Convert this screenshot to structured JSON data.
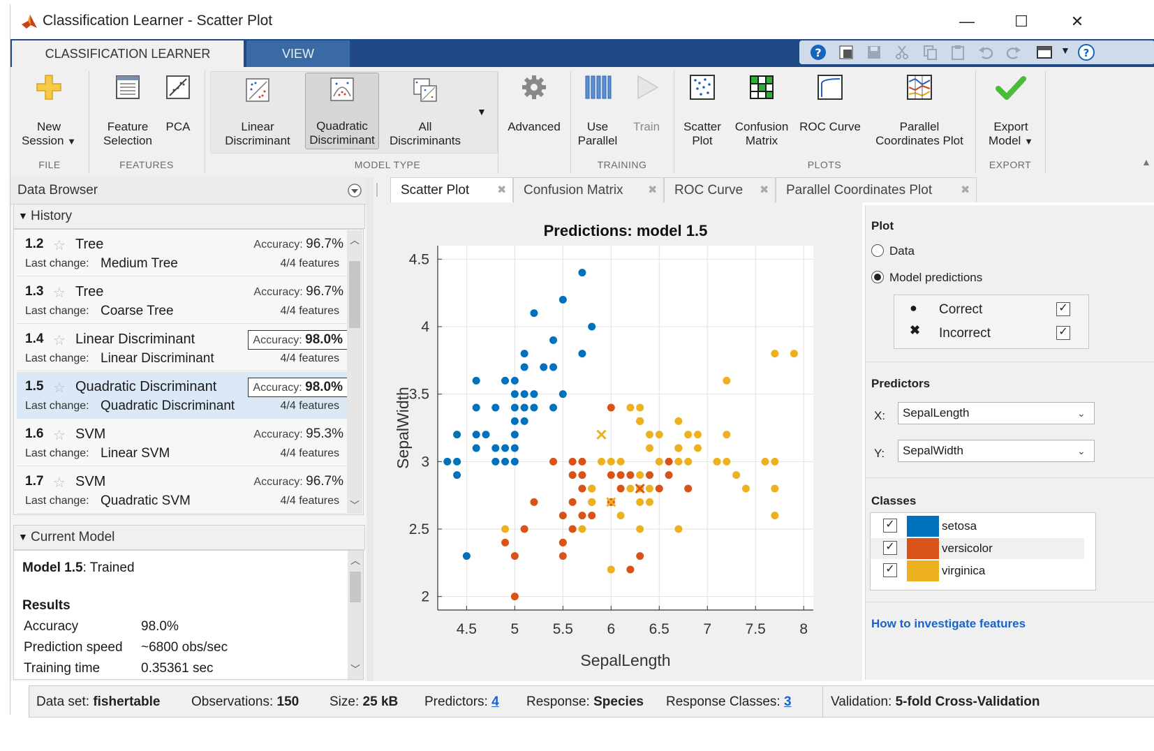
{
  "window": {
    "title": "Classification Learner - Scatter Plot",
    "minimize": "—",
    "maximize": "☐",
    "close": "✕"
  },
  "ribbon_tabs": [
    "CLASSIFICATION LEARNER",
    "VIEW"
  ],
  "ribbon": {
    "new_session": [
      "New",
      "Session"
    ],
    "feature_selection": [
      "Feature",
      "Selection"
    ],
    "pca": "PCA",
    "linear_discriminant": [
      "Linear",
      "Discriminant"
    ],
    "quadratic_discriminant": [
      "Quadratic",
      "Discriminant"
    ],
    "all_discriminants": [
      "All",
      "Discriminants"
    ],
    "advanced": "Advanced",
    "use_parallel": [
      "Use",
      "Parallel"
    ],
    "train": "Train",
    "scatter_plot": [
      "Scatter",
      "Plot"
    ],
    "confusion_matrix": [
      "Confusion",
      "Matrix"
    ],
    "roc_curve": "ROC Curve",
    "parallel_coordinates_plot": [
      "Parallel",
      "Coordinates Plot"
    ],
    "export_model": [
      "Export",
      "Model"
    ],
    "groups": [
      "FILE",
      "FEATURES",
      "MODEL TYPE",
      "TRAINING",
      "PLOTS",
      "EXPORT"
    ]
  },
  "data_browser": {
    "title": "Data Browser",
    "history_label": "History",
    "history": [
      {
        "id": "1.2",
        "name": "Tree",
        "accuracy_label": "Accuracy:",
        "accuracy": "96.7%",
        "last_change_label": "Last change:",
        "last_change": "Medium Tree",
        "features": "4/4 features",
        "highlight": false,
        "selected": false
      },
      {
        "id": "1.3",
        "name": "Tree",
        "accuracy_label": "Accuracy:",
        "accuracy": "96.7%",
        "last_change_label": "Last change:",
        "last_change": "Coarse Tree",
        "features": "4/4 features",
        "highlight": false,
        "selected": false
      },
      {
        "id": "1.4",
        "name": "Linear Discriminant",
        "accuracy_label": "Accuracy:",
        "accuracy": "98.0%",
        "last_change_label": "Last change:",
        "last_change": "Linear Discriminant",
        "features": "4/4 features",
        "highlight": true,
        "selected": false
      },
      {
        "id": "1.5",
        "name": "Quadratic Discriminant",
        "accuracy_label": "Accuracy:",
        "accuracy": "98.0%",
        "last_change_label": "Last change:",
        "last_change": "Quadratic Discriminant",
        "features": "4/4 features",
        "highlight": true,
        "selected": true
      },
      {
        "id": "1.6",
        "name": "SVM",
        "accuracy_label": "Accuracy:",
        "accuracy": "95.3%",
        "last_change_label": "Last change:",
        "last_change": "Linear SVM",
        "features": "4/4 features",
        "highlight": false,
        "selected": false
      },
      {
        "id": "1.7",
        "name": "SVM",
        "accuracy_label": "Accuracy:",
        "accuracy": "96.7%",
        "last_change_label": "Last change:",
        "last_change": "Quadratic SVM",
        "features": "4/4 features",
        "highlight": false,
        "selected": false
      }
    ],
    "current_model_label": "Current Model",
    "current_model": {
      "model_label": "Model 1.5",
      "model_status": ": Trained",
      "results_label": "Results",
      "rows": [
        {
          "label": "Accuracy",
          "value": "98.0%"
        },
        {
          "label": "Prediction speed",
          "value": "~6800 obs/sec"
        },
        {
          "label": "Training time",
          "value": "0.35361 sec"
        }
      ]
    }
  },
  "doc_tabs": [
    "Scatter Plot",
    "Confusion Matrix",
    "ROC Curve",
    "Parallel Coordinates Plot"
  ],
  "plot_options": {
    "plot_label": "Plot",
    "data_option": "Data",
    "model_predictions_option": "Model predictions",
    "selected_option": "Model predictions",
    "correct_label": "Correct",
    "correct_checked": true,
    "incorrect_label": "Incorrect",
    "incorrect_checked": true,
    "predictors_label": "Predictors",
    "x_label": "X:",
    "x_value": "SepalLength",
    "y_label": "Y:",
    "y_value": "SepalWidth",
    "classes_label": "Classes",
    "classes": [
      {
        "name": "setosa",
        "color": "#0072bd",
        "checked": true
      },
      {
        "name": "versicolor",
        "color": "#d95319",
        "checked": true
      },
      {
        "name": "virginica",
        "color": "#edb120",
        "checked": true
      }
    ],
    "help_link": "How to investigate features"
  },
  "status_bar": {
    "dataset_label": "Data set:",
    "dataset": "fishertable",
    "observations_label": "Observations:",
    "observations": "150",
    "size_label": "Size:",
    "size": "25 kB",
    "predictors_label": "Predictors:",
    "predictors": "4",
    "response_label": "Response:",
    "response": "Species",
    "response_classes_label": "Response Classes:",
    "response_classes": "3",
    "validation_label": "Validation:",
    "validation": "5-fold Cross-Validation"
  },
  "chart_data": {
    "type": "scatter",
    "title": "Predictions: model 1.5",
    "xlabel": "SepalLength",
    "ylabel": "SepalWidth",
    "xlim": [
      4.2,
      8.1
    ],
    "ylim": [
      1.9,
      4.6
    ],
    "xticks": [
      "4.5",
      "5",
      "5.5",
      "6",
      "6.5",
      "7",
      "7.5",
      "8"
    ],
    "yticks": [
      "2",
      "2.5",
      "3",
      "3.5",
      "4",
      "4.5"
    ],
    "grid": true,
    "series": [
      {
        "name": "setosa",
        "color": "#0072bd",
        "marker": "dot",
        "points": [
          [
            5.7,
            4.4
          ],
          [
            5.5,
            4.2
          ],
          [
            5.2,
            4.1
          ],
          [
            5.8,
            4.0
          ],
          [
            5.4,
            3.9
          ],
          [
            5.1,
            3.8
          ],
          [
            5.7,
            3.8
          ],
          [
            5.1,
            3.7
          ],
          [
            5.3,
            3.7
          ],
          [
            5.4,
            3.7
          ],
          [
            4.6,
            3.6
          ],
          [
            4.9,
            3.6
          ],
          [
            5.0,
            3.6
          ],
          [
            5.5,
            3.5
          ],
          [
            5.0,
            3.5
          ],
          [
            5.1,
            3.5
          ],
          [
            5.2,
            3.5
          ],
          [
            4.6,
            3.4
          ],
          [
            4.8,
            3.4
          ],
          [
            5.0,
            3.4
          ],
          [
            5.1,
            3.4
          ],
          [
            5.2,
            3.4
          ],
          [
            5.4,
            3.4
          ],
          [
            5.0,
            3.3
          ],
          [
            5.1,
            3.3
          ],
          [
            4.4,
            3.2
          ],
          [
            4.6,
            3.2
          ],
          [
            4.7,
            3.2
          ],
          [
            5.0,
            3.2
          ],
          [
            4.6,
            3.1
          ],
          [
            4.8,
            3.1
          ],
          [
            4.9,
            3.1
          ],
          [
            5.0,
            3.1
          ],
          [
            4.3,
            3.0
          ],
          [
            4.4,
            3.0
          ],
          [
            4.8,
            3.0
          ],
          [
            4.9,
            3.0
          ],
          [
            5.0,
            3.0
          ],
          [
            4.4,
            2.9
          ],
          [
            4.5,
            2.3
          ]
        ]
      },
      {
        "name": "versicolor",
        "color": "#d95319",
        "marker": "dot",
        "points": [
          [
            6.0,
            3.4
          ],
          [
            6.7,
            3.1
          ],
          [
            6.3,
            3.3
          ],
          [
            5.4,
            3.0
          ],
          [
            5.6,
            3.0
          ],
          [
            5.7,
            3.0
          ],
          [
            6.6,
            3.0
          ],
          [
            5.6,
            2.9
          ],
          [
            5.7,
            2.9
          ],
          [
            6.0,
            2.9
          ],
          [
            6.1,
            2.9
          ],
          [
            6.2,
            2.9
          ],
          [
            6.4,
            2.9
          ],
          [
            6.6,
            2.9
          ],
          [
            5.7,
            2.8
          ],
          [
            5.8,
            2.8
          ],
          [
            6.1,
            2.8
          ],
          [
            6.8,
            2.8
          ],
          [
            6.5,
            2.8
          ],
          [
            5.8,
            2.7
          ],
          [
            5.2,
            2.7
          ],
          [
            5.6,
            2.7
          ],
          [
            6.0,
            2.7
          ],
          [
            5.5,
            2.6
          ],
          [
            5.7,
            2.6
          ],
          [
            5.8,
            2.6
          ],
          [
            5.6,
            2.5
          ],
          [
            5.5,
            2.4
          ],
          [
            5.1,
            2.5
          ],
          [
            4.9,
            2.4
          ],
          [
            5.5,
            2.4
          ],
          [
            5.0,
            2.3
          ],
          [
            5.5,
            2.3
          ],
          [
            6.3,
            2.3
          ],
          [
            6.2,
            2.2
          ],
          [
            5.0,
            2.0
          ]
        ]
      },
      {
        "name": "virginica",
        "color": "#edb120",
        "marker": "dot",
        "points": [
          [
            7.7,
            3.8
          ],
          [
            7.9,
            3.8
          ],
          [
            7.2,
            3.6
          ],
          [
            6.2,
            3.4
          ],
          [
            6.3,
            3.4
          ],
          [
            6.3,
            3.3
          ],
          [
            6.7,
            3.3
          ],
          [
            6.4,
            3.2
          ],
          [
            6.5,
            3.2
          ],
          [
            6.8,
            3.2
          ],
          [
            6.9,
            3.2
          ],
          [
            7.2,
            3.2
          ],
          [
            6.4,
            3.1
          ],
          [
            6.7,
            3.1
          ],
          [
            6.9,
            3.1
          ],
          [
            5.9,
            3.0
          ],
          [
            6.0,
            3.0
          ],
          [
            6.1,
            3.0
          ],
          [
            6.5,
            3.0
          ],
          [
            6.7,
            3.0
          ],
          [
            6.8,
            3.0
          ],
          [
            7.1,
            3.0
          ],
          [
            7.2,
            3.0
          ],
          [
            7.6,
            3.0
          ],
          [
            7.7,
            3.0
          ],
          [
            6.4,
            2.8
          ],
          [
            5.8,
            2.8
          ],
          [
            6.3,
            2.9
          ],
          [
            7.3,
            2.9
          ],
          [
            6.2,
            2.8
          ],
          [
            6.3,
            2.8
          ],
          [
            7.4,
            2.8
          ],
          [
            7.7,
            2.8
          ],
          [
            5.8,
            2.7
          ],
          [
            6.4,
            2.7
          ],
          [
            6.3,
            2.7
          ],
          [
            6.1,
            2.6
          ],
          [
            7.7,
            2.6
          ],
          [
            4.9,
            2.5
          ],
          [
            5.7,
            2.5
          ],
          [
            6.3,
            2.5
          ],
          [
            6.7,
            2.5
          ],
          [
            6.0,
            2.2
          ]
        ]
      },
      {
        "name": "incorrect",
        "marker": "x",
        "points": [
          {
            "x": 5.9,
            "y": 3.2,
            "color": "#edb120"
          },
          {
            "x": 6.0,
            "y": 2.7,
            "color": "#edb120"
          },
          {
            "x": 6.3,
            "y": 2.8,
            "color": "#d95319"
          }
        ]
      }
    ]
  }
}
